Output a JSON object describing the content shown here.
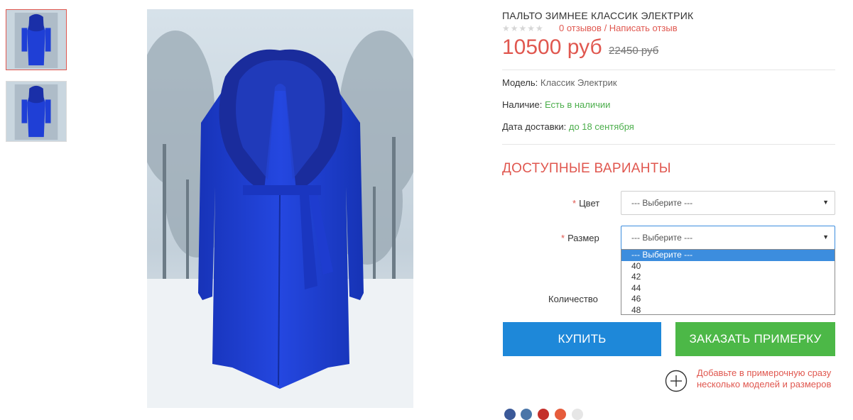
{
  "product": {
    "title": "ПАЛЬТО ЗИМНЕЕ КЛАССИК ЭЛЕКТРИК",
    "stars": "★★★★★",
    "rating": 0,
    "reviews_link": "0 отзывов",
    "reviews_sep": " / ",
    "write_review_link": "Написать отзыв",
    "price": "10500 руб",
    "old_price": "22450 руб"
  },
  "info": {
    "model_label": "Модель:",
    "model_value": "Классик Электрик",
    "stock_label": "Наличие:",
    "stock_value": "Есть в наличии",
    "delivery_label": "Дата доставки:",
    "delivery_value": "до 18 сентября"
  },
  "options": {
    "title": "ДОСТУПНЫЕ ВАРИАНТЫ",
    "required_mark": "*",
    "color_label": "Цвет",
    "color_value": "--- Выберите ---",
    "size_label": "Размер",
    "size_value": "--- Выберите ---",
    "size_options": [
      "--- Выберите ---",
      "40",
      "42",
      "44",
      "46",
      "48"
    ],
    "qty_label": "Количество"
  },
  "actions": {
    "buy_label": "КУПИТЬ",
    "fitting_label": "ЗАКАЗАТЬ ПРИМЕРКУ",
    "fitting_note": "Добавьте в примерочную сразу несколько моделей и размеров"
  },
  "colors": {
    "accent_red": "#e0574f",
    "buy_blue": "#1e88d9",
    "fitting_green": "#4cb847",
    "stock_green": "#4cae4c",
    "coat_blue": "#1f3fd6"
  },
  "icons": {
    "select_arrow": "caret-down-icon",
    "add_fitting": "plus-circle-icon"
  }
}
